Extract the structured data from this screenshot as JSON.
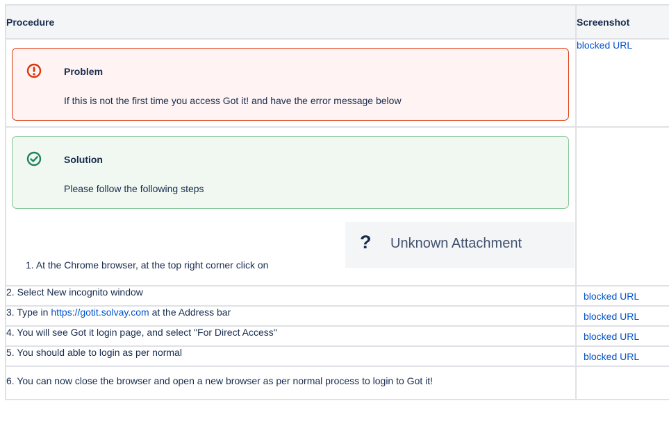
{
  "table": {
    "headers": [
      "Procedure",
      "Screenshot"
    ],
    "problem": {
      "title": "Problem",
      "body": "If this is not the first time you access Got it! and have the error message below",
      "screenshot_link": "blocked URL"
    },
    "solution": {
      "title": "Solution",
      "body": "Please follow the following steps"
    },
    "step1": {
      "number": "1.",
      "text": "At the Chrome browser, at the top right corner click on",
      "attachment_symbol": "?",
      "attachment_label": "Unknown Attachment"
    },
    "steps": [
      {
        "prefix": "2. ",
        "text": "Select New incognito window",
        "link": "",
        "screenshot_link": "blocked URL"
      },
      {
        "prefix": "3. ",
        "text": "Type in ",
        "link": "https://gotit.solvay.com",
        "suffix": " at the Address bar",
        "screenshot_link": "blocked URL"
      },
      {
        "prefix": "4. ",
        "text": "You will see Got it login page, and select \"For Direct Access\"",
        "link": "",
        "screenshot_link": "blocked URL"
      },
      {
        "prefix": "5. ",
        "text": "You should able to login as per normal",
        "link": "",
        "screenshot_link": "blocked URL"
      },
      {
        "prefix": "6. ",
        "text": "You can now close the browser and open a new browser as per normal process to login to Got it!",
        "link": "",
        "screenshot_link": ""
      }
    ]
  },
  "icons": {
    "problem": "exclamation-circle-icon",
    "solution": "check-circle-icon",
    "attachment": "question-mark-icon"
  },
  "colors": {
    "error_border": "#de350b",
    "error_bg": "#fff4f3",
    "success_border": "#7fc494",
    "success_bg": "#f0f8f1",
    "link": "#0052cc"
  }
}
